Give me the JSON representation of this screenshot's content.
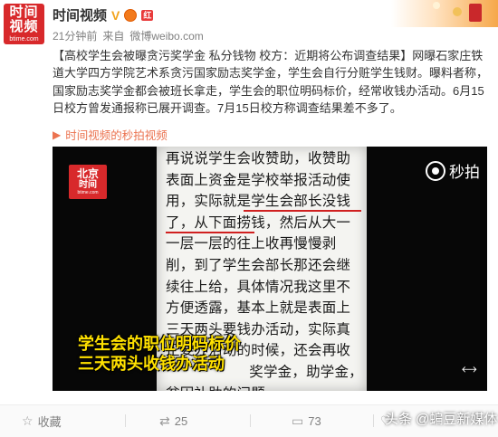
{
  "header": {
    "avatar_top": "时间",
    "avatar_bottom": "视频",
    "avatar_sub": "btime.com",
    "author": "时间视频",
    "verified_badge": "V",
    "badge_text": "红",
    "time_ago": "21分钟前",
    "source_prefix": "来自",
    "source": "微博weibo.com"
  },
  "post": {
    "text": "【高校学生会被曝贪污奖学金 私分钱物 校方：近期将公布调查结果】网曝石家庄铁道大学四方学院艺术系贪污国家励志奖学金，学生会自行分赃学生钱财。曝料者称，国家励志奖学金都会被班长拿走，学生会的职位明码标价，经常收钱办活动。6月15日校方曾发通报称已展开调查。7月15日校方称调查结果差不多了。",
    "video_link": "时间视频的秒拍视频",
    "video_link_icon": "play-circle-icon"
  },
  "video": {
    "logo_line1": "北京",
    "logo_line2": "时间",
    "logo_line3": "btime.com",
    "miaopai_label": "秒拍",
    "sheet_lines": [
      "再说说学生会收赞助，收赞助",
      "表面上资金是学校举报活动使",
      "用，实际就是学生会部长没钱",
      "了，从下面捞钱，然后从大一",
      "一层一层的往上收再慢慢剥",
      "削，到了学生会部长那还会继",
      "续往上给，具体情况我这里不",
      "方便透露，基本上就是表面上",
      "三天两头要钱办活动，实际真",
      "正要办活动的时候，还会再收",
      "                  奖学金，助学金，",
      "贫困补助的问题"
    ],
    "caption_line1": "学生会的职位明码标价",
    "caption_line2": "三天两头收钱办活动",
    "highlight_color": "#ffe100",
    "underline_color": "#d02020"
  },
  "actions": {
    "favorite_label": "收藏",
    "repost_count": "25",
    "comment_count": "73",
    "like_count": ""
  },
  "watermark": "头条 @蝙豆新媒体",
  "colors": {
    "brand_red": "#d8292b",
    "link_orange": "#eb7350",
    "text": "#333333",
    "meta_gray": "#808080"
  }
}
